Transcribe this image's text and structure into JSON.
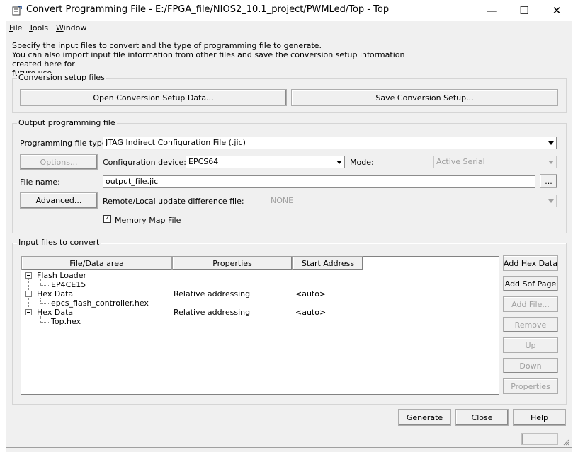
{
  "window": {
    "title": "Convert Programming File - E:/FPGA_file/NIOS2_10.1_project/PWMLed/Top - Top",
    "minimize_glyph": "—",
    "maximize_glyph": "☐",
    "close_glyph": "✕"
  },
  "menu": [
    {
      "key": "F",
      "rest": "ile"
    },
    {
      "key": "T",
      "rest": "ools"
    },
    {
      "key": "W",
      "rest": "indow"
    }
  ],
  "description": {
    "line1": "Specify the input files to convert and the type of programming file to generate.",
    "line2": "You can also import input file information from other files and save the conversion setup information created here for",
    "line3": "future use."
  },
  "conversion_setup": {
    "group_label": "Conversion setup files",
    "open_button": "Open Conversion Setup Data...",
    "save_button": "Save Conversion Setup..."
  },
  "output": {
    "group_label": "Output programming file",
    "file_type_label": "Programming file type:",
    "file_type_value": "JTAG Indirect Configuration File (.jic)",
    "options_button": "Options...",
    "config_device_label": "Configuration device:",
    "config_device_value": "EPCS64",
    "mode_label": "Mode:",
    "mode_value": "Active Serial",
    "file_name_label": "File name:",
    "file_name_value": "output_file.jic",
    "browse_button": "...",
    "advanced_button": "Advanced...",
    "remote_label": "Remote/Local update difference file:",
    "remote_value": "NONE",
    "memory_map_label": "Memory Map File",
    "memory_map_checked": "✓"
  },
  "input_files": {
    "group_label": "Input files to convert",
    "columns": [
      "File/Data area",
      "Properties",
      "Start Address"
    ],
    "rows": [
      {
        "name": "Flash Loader",
        "properties": "",
        "address": "",
        "level": 0
      },
      {
        "name": "EP4CE15",
        "properties": "",
        "address": "",
        "level": 1
      },
      {
        "name": "Hex Data",
        "properties": "Relative addressing",
        "address": "<auto>",
        "level": 0
      },
      {
        "name": "epcs_flash_controller.hex",
        "properties": "",
        "address": "",
        "level": 1
      },
      {
        "name": "Hex Data",
        "properties": "Relative addressing",
        "address": "<auto>",
        "level": 0
      },
      {
        "name": "Top.hex",
        "properties": "",
        "address": "",
        "level": 1
      }
    ],
    "buttons": {
      "add_hex": "Add Hex Data",
      "add_sof": "Add Sof Page",
      "add_file": "Add File...",
      "remove": "Remove",
      "up": "Up",
      "down": "Down",
      "properties": "Properties"
    }
  },
  "footer": {
    "generate": "Generate",
    "close": "Close",
    "help": "Help"
  },
  "colors": {
    "face": "#f0f0f0",
    "disabled_text": "#a0a0a0"
  }
}
